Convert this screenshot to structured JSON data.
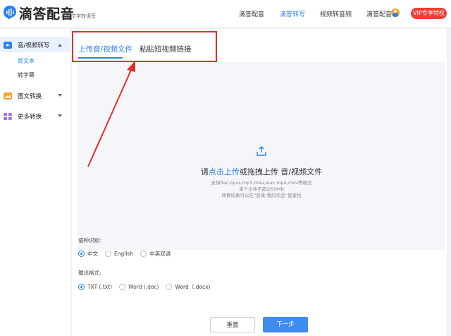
{
  "header": {
    "brand": "滴答配音",
    "slogan": "在线文字转语音",
    "nav": [
      {
        "label": "滴答配音",
        "active": false
      },
      {
        "label": "滴答转写",
        "active": true
      },
      {
        "label": "视频转音频",
        "active": false
      },
      {
        "label": "滴答配音",
        "active": false
      }
    ],
    "vip_label": "VIP专享特权"
  },
  "sidebar": {
    "groups": [
      {
        "label": "音/视频转写",
        "icon": "video-icon",
        "expanded": true
      },
      {
        "label": "图文转换",
        "icon": "image-icon",
        "expanded": false
      },
      {
        "label": "更多转换",
        "icon": "grid-icon",
        "expanded": false
      }
    ],
    "sub_items": [
      {
        "label": "转文本",
        "active": true
      },
      {
        "label": "转字幕",
        "active": false
      }
    ]
  },
  "tabs": [
    {
      "label": "上传音/视频文件",
      "active": true
    },
    {
      "label": "粘贴短视频链接",
      "active": false
    }
  ],
  "upload": {
    "title_prefix": "请",
    "title_link": "点击上传",
    "title_suffix": "或拖拽上传 音/视频文件",
    "hint_formats": "支持flac,opus,mp3,m4a,wav,mp4,mov等格式",
    "hint_size": "单个文件不超过50MB",
    "hint_result": "转换结果可以在“登录-我的作品”里查找"
  },
  "language": {
    "label": "语种识别:",
    "options": [
      {
        "label": "中文",
        "checked": true
      },
      {
        "label": "English",
        "checked": false
      },
      {
        "label": "中英双语",
        "checked": false
      }
    ]
  },
  "output": {
    "label": "输出格式:",
    "options": [
      {
        "label": "TXT (.txt)",
        "checked": true
      },
      {
        "label": "Word (.doc)",
        "checked": false
      },
      {
        "label": "Word（.docx)",
        "checked": false
      }
    ]
  },
  "buttons": {
    "reset": "重置",
    "next": "下一步"
  },
  "colors": {
    "accent": "#2a7ff0",
    "vip": "#ef3e36",
    "annotation": "#e0302a"
  }
}
